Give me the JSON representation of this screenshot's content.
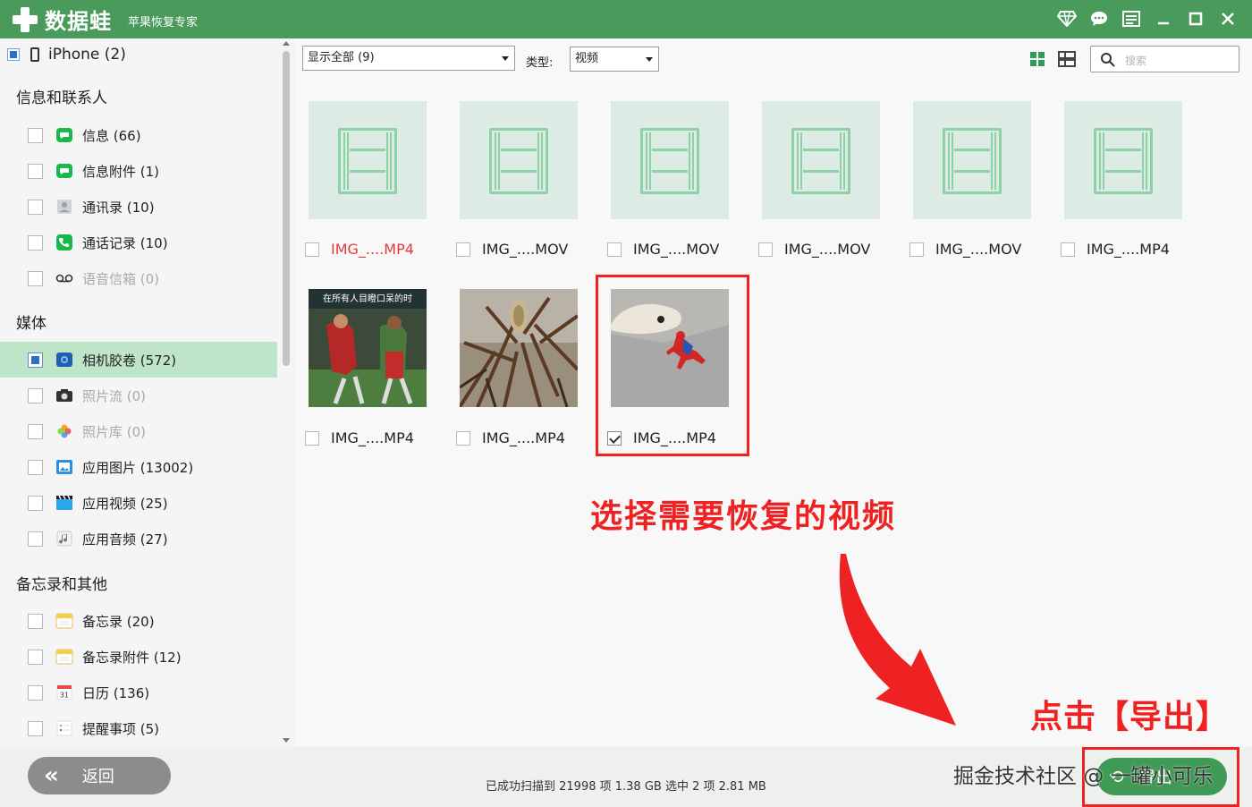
{
  "app": {
    "name": "数据蛙",
    "subtitle": "苹果恢复专家"
  },
  "sidebar": {
    "device": "iPhone (2)",
    "groups": [
      {
        "title": "信息和联系人"
      },
      {
        "title": "媒体"
      },
      {
        "title": "备忘录和其他"
      }
    ],
    "items": [
      {
        "label": "信息 (66)"
      },
      {
        "label": "信息附件 (1)"
      },
      {
        "label": "通讯录 (10)"
      },
      {
        "label": "通话记录 (10)"
      },
      {
        "label": "语音信箱 (0)"
      },
      {
        "label": "相机胶卷 (572)"
      },
      {
        "label": "照片流 (0)"
      },
      {
        "label": "照片库 (0)"
      },
      {
        "label": "应用图片 (13002)"
      },
      {
        "label": "应用视频 (25)"
      },
      {
        "label": "应用音频 (27)"
      },
      {
        "label": "备忘录 (20)"
      },
      {
        "label": "备忘录附件 (12)"
      },
      {
        "label": "日历 (136)"
      },
      {
        "label": "提醒事项 (5)"
      }
    ]
  },
  "toolbar": {
    "filter_value": "显示全部 (9)",
    "type_label": "类型:",
    "type_value": "视频",
    "search_placeholder": "搜索"
  },
  "files": [
    {
      "name": "IMG_....MP4"
    },
    {
      "name": "IMG_....MOV"
    },
    {
      "name": "IMG_....MOV"
    },
    {
      "name": "IMG_....MOV"
    },
    {
      "name": "IMG_....MOV"
    },
    {
      "name": "IMG_....MP4"
    },
    {
      "name": "IMG_....MP4"
    },
    {
      "name": "IMG_....MP4"
    },
    {
      "name": "IMG_....MP4"
    }
  ],
  "annotations": {
    "select_hint": "选择需要恢复的视频",
    "export_hint": "点击【导出】"
  },
  "bottom": {
    "back_label": "返回",
    "status": "已成功扫描到 21998 项 1.38 GB  选中 2 项 2.81 MB",
    "export_label": "导出",
    "watermark": "掘金技术社区 @ 一罐小可乐"
  },
  "colors": {
    "brand": "#4a9a5c",
    "highlight": "#e22222",
    "active_row": "#bfe5c8"
  }
}
